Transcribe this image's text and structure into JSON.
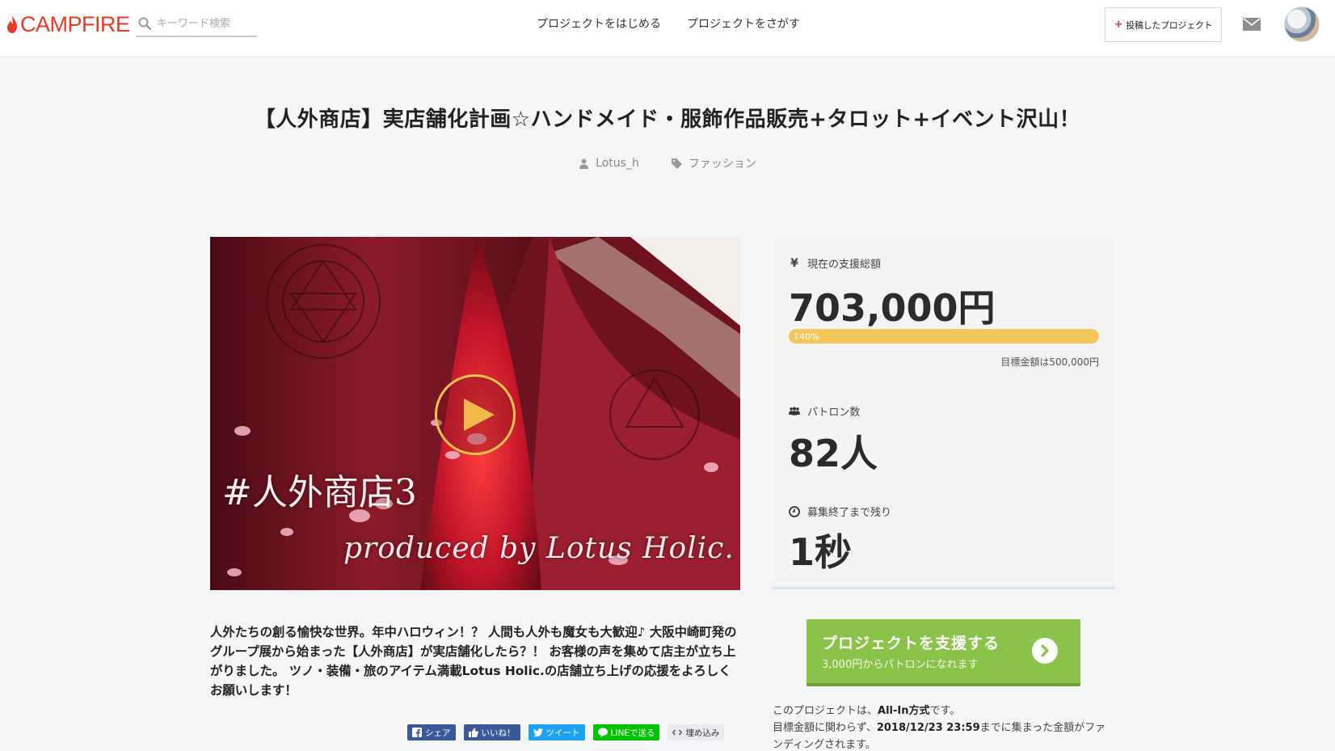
{
  "header": {
    "logo_text": "CAMPFIRE",
    "search_placeholder": "キーワード検索",
    "nav": [
      "プロジェクトをはじめる",
      "プロジェクトをさがす"
    ],
    "posted_button_label": "投稿したプロジェクト",
    "icons": [
      "flame-icon",
      "search-icon",
      "mail-icon",
      "avatar"
    ],
    "logo_color": "#e83828"
  },
  "project": {
    "title": "【人外商店】実店舗化計画☆ハンドメイド・服飾作品販売+タロット+イベント沢山！",
    "author": "Lotus_h",
    "category": "ファッション",
    "video": {
      "caption": "#人外商店3",
      "credit": "produced by Lotus Holic."
    },
    "description": "人外たちの創る愉快な世界。年中ハロウィン！？ 人間も人外も魔女も大歓迎♪ 大阪中崎町発のグループ展から始まった【人外商店】が実店舗化したら？！ お客様の声を集めて店主が立ち上がりました。 ツノ・装備・旅のアイテム満載Lotus Holic.の店舗立ち上げの応援をよろしくお願いします！"
  },
  "stats": {
    "funding_label": "現在の支援総額",
    "funding_amount": "703,000円",
    "progress_text": "140%",
    "progress_fraction": 1.0,
    "goal_text": "目標金額は500,000円",
    "patrons_label": "パトロン数",
    "patrons_value": "82人",
    "remaining_label": "募集終了まで残り",
    "remaining_value": "1秒",
    "progress_color": "#f5c75a"
  },
  "share": {
    "facebook_share": "シェア",
    "facebook_like": "いいね！",
    "tweet": "ツイート",
    "line": "LINEで送る",
    "embed": "埋め込み"
  },
  "support": {
    "button_main": "プロジェクトを支援する",
    "button_sub": "3,000円からパトロンになれます",
    "color": "#8bc34a"
  },
  "allin": {
    "prefix": "このプロジェクトは、",
    "method": "All-In方式",
    "suffix": "です。",
    "line2_prefix": "目標金額に関わらず、",
    "deadline": "2018/12/23 23:59",
    "line2_suffix": "までに集まった金額がファンディングされます。"
  }
}
